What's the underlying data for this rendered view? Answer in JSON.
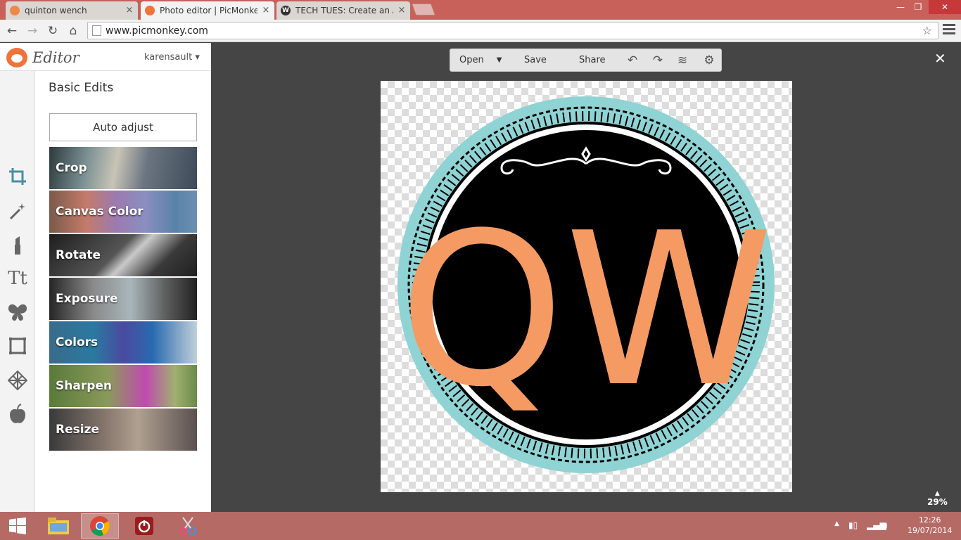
{
  "browser": {
    "tabs": [
      {
        "label": "quinton wench",
        "color": "#f0884b"
      },
      {
        "label": "Photo editor | PicMonkey:",
        "color": "#f0733b"
      },
      {
        "label": "TECH TUES: Create an App",
        "color": "#333333",
        "icon_letter": "W"
      }
    ],
    "url": "www.picmonkey.com"
  },
  "editor": {
    "title": "Editor",
    "user": "karensault",
    "panel_title": "Basic Edits",
    "auto_adjust": "Auto adjust",
    "tools": [
      "crop-icon",
      "magic-wand-icon",
      "lipstick-icon",
      "text-icon",
      "butterfly-icon",
      "frame-icon",
      "texture-icon",
      "apple-icon"
    ],
    "tiles": [
      "Crop",
      "Canvas Color",
      "Rotate",
      "Exposure",
      "Colors",
      "Sharpen",
      "Resize"
    ]
  },
  "canvas_toolbar": {
    "open": "Open",
    "save": "Save",
    "share": "Share"
  },
  "canvas": {
    "monogram": "QW",
    "zoom": "29%",
    "ring_color": "#8fd3d4",
    "monogram_color": "#f59a62"
  },
  "taskbar": {
    "time": "12:26",
    "date": "19/07/2014"
  }
}
